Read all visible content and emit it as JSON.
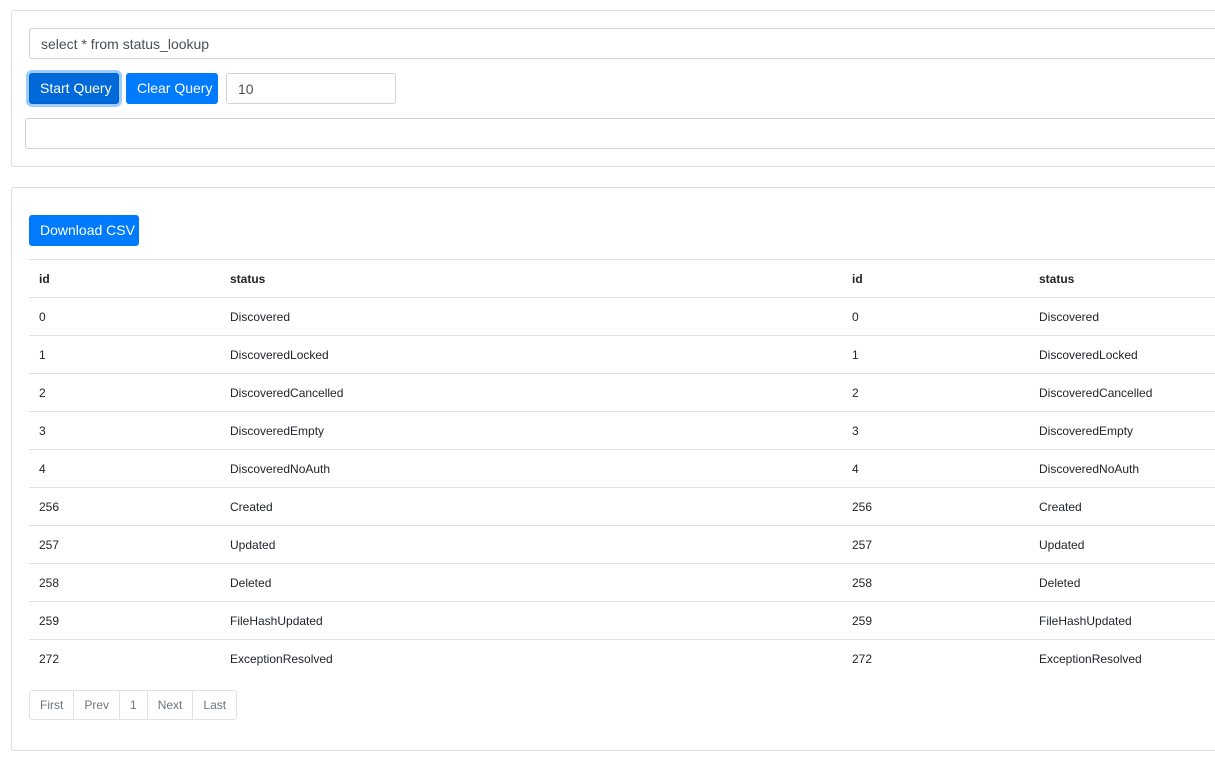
{
  "query": {
    "sql_value": "select * from status_lookup",
    "start_label": "Start Query",
    "clear_label": "Clear Query",
    "limit_value": "10",
    "output_value": ""
  },
  "results": {
    "download_label": "Download CSV",
    "columns": [
      "id",
      "status",
      "id",
      "status"
    ],
    "rows": [
      [
        "0",
        "Discovered",
        "0",
        "Discovered"
      ],
      [
        "1",
        "DiscoveredLocked",
        "1",
        "DiscoveredLocked"
      ],
      [
        "2",
        "DiscoveredCancelled",
        "2",
        "DiscoveredCancelled"
      ],
      [
        "3",
        "DiscoveredEmpty",
        "3",
        "DiscoveredEmpty"
      ],
      [
        "4",
        "DiscoveredNoAuth",
        "4",
        "DiscoveredNoAuth"
      ],
      [
        "256",
        "Created",
        "256",
        "Created"
      ],
      [
        "257",
        "Updated",
        "257",
        "Updated"
      ],
      [
        "258",
        "Deleted",
        "258",
        "Deleted"
      ],
      [
        "259",
        "FileHashUpdated",
        "259",
        "FileHashUpdated"
      ],
      [
        "272",
        "ExceptionResolved",
        "272",
        "ExceptionResolved"
      ]
    ]
  },
  "pagination": {
    "first": "First",
    "prev": "Prev",
    "current": "1",
    "next": "Next",
    "last": "Last"
  },
  "colors": {
    "primary": "#007bff",
    "primary_active": "#0069d9",
    "border": "#dee2e6",
    "muted_text": "#6c757d"
  }
}
